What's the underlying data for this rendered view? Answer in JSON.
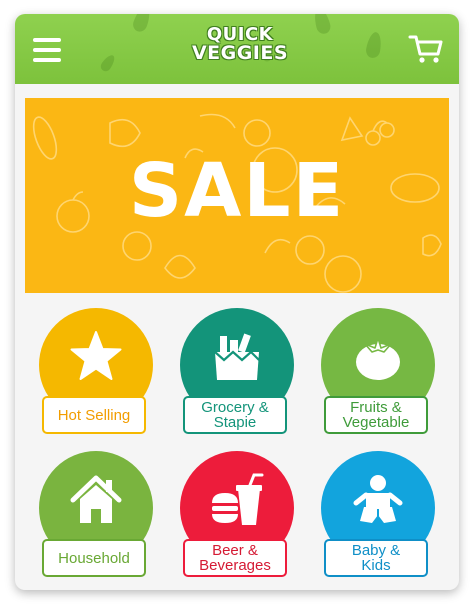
{
  "header": {
    "logo_line1": "QUICK",
    "logo_line2": "VEGGIES",
    "menu_icon": "hamburger-menu-icon",
    "cart_icon": "shopping-cart-icon"
  },
  "banner": {
    "text": "SALE",
    "background": "#fbb714"
  },
  "categories": [
    {
      "label": "Hot Selling",
      "icon": "star-icon",
      "color": "#f5b800",
      "text_color": "#f29d00"
    },
    {
      "label": "Grocery &\nStapie",
      "icon": "grocery-bag-icon",
      "color": "#13947a",
      "text_color": "#13947a"
    },
    {
      "label": "Fruits &\nVegetable",
      "icon": "tomato-icon",
      "color": "#76b843",
      "text_color": "#3f9b3a"
    },
    {
      "label": "Household",
      "icon": "house-icon",
      "color": "#7ab43f",
      "text_color": "#69a834"
    },
    {
      "label": "Beer &\nBeverages",
      "icon": "burger-drink-icon",
      "color": "#ed1c3b",
      "text_color": "#d51a34"
    },
    {
      "label": "Baby &\nKids",
      "icon": "baby-icon",
      "color": "#12a4dd",
      "text_color": "#0f8fc7"
    }
  ]
}
